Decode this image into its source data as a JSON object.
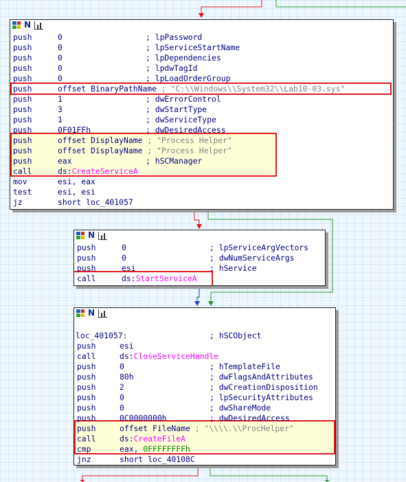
{
  "colors": {
    "canvas_bg": "#eef7fd",
    "code_text": "#000080",
    "api_name": "#ff00ff",
    "numeric_constant": "#008000",
    "string_comment": "#808080",
    "highlight_bg": "#ffffd7",
    "annotation_box": "#e0191e",
    "edge_taken": "#e0191e",
    "edge_not_taken": "#2a9a2a",
    "edge_unconditional": "#1e40c8"
  },
  "node_header_icons": [
    "graph-overview-icon",
    "node-name-icon",
    "node-stats-icon"
  ],
  "blocks": [
    {
      "id": "block1",
      "lines": [
        {
          "mnemonic": "push",
          "operand": "0",
          "comment": "; lpPassword"
        },
        {
          "mnemonic": "push",
          "operand": "0",
          "comment": "; lpServiceStartName"
        },
        {
          "mnemonic": "push",
          "operand": "0",
          "comment": "; lpDependencies"
        },
        {
          "mnemonic": "push",
          "operand": "0",
          "comment": "; lpdwTagId"
        },
        {
          "mnemonic": "push",
          "operand": "0",
          "comment": "; lpLoadOrderGroup"
        },
        {
          "mnemonic": "push",
          "operand": "offset BinaryPathName",
          "comment": "; \"C:\\\\Windows\\\\System32\\\\Lab10-03.sys\""
        },
        {
          "mnemonic": "push",
          "operand": "1",
          "comment": "; dwErrorControl"
        },
        {
          "mnemonic": "push",
          "operand": "3",
          "comment": "; dwStartType"
        },
        {
          "mnemonic": "push",
          "operand": "1",
          "comment": "; dwServiceType"
        },
        {
          "mnemonic": "push",
          "operand": "0F01FFh",
          "comment": "; dwDesiredAccess"
        },
        {
          "mnemonic": "push",
          "operand": "offset DisplayName",
          "comment": "; \"Process Helper\""
        },
        {
          "mnemonic": "push",
          "operand": "offset DisplayName",
          "comment": "; \"Process Helper\""
        },
        {
          "mnemonic": "push",
          "operand": "eax",
          "comment": "; hSCManager"
        },
        {
          "mnemonic": "call",
          "operand": "ds:",
          "operand_api": "CreateServiceA",
          "comment": ""
        },
        {
          "mnemonic": "mov",
          "operand": "esi, eax",
          "comment": ""
        },
        {
          "mnemonic": "test",
          "operand": "esi, esi",
          "comment": ""
        },
        {
          "mnemonic": "jz",
          "operand": "short loc_401057",
          "comment": ""
        }
      ]
    },
    {
      "id": "block2",
      "lines": [
        {
          "mnemonic": "push",
          "operand": "0",
          "comment": "; lpServiceArgVectors"
        },
        {
          "mnemonic": "push",
          "operand": "0",
          "comment": "; dwNumServiceArgs"
        },
        {
          "mnemonic": "push",
          "operand": "esi",
          "comment": "; hService"
        },
        {
          "mnemonic": "call",
          "operand": "ds:",
          "operand_api": "StartServiceA",
          "comment": ""
        }
      ]
    },
    {
      "id": "block3",
      "label_line": {
        "label": "loc_401057:",
        "comment": "; hSCObject"
      },
      "lines": [
        {
          "mnemonic": "push",
          "operand": "esi",
          "comment": ""
        },
        {
          "mnemonic": "call",
          "operand": "ds:",
          "operand_api": "CloseServiceHandle",
          "comment": ""
        },
        {
          "mnemonic": "push",
          "operand": "0",
          "comment": "; hTemplateFile"
        },
        {
          "mnemonic": "push",
          "operand": "80h",
          "comment": "; dwFlagsAndAttributes"
        },
        {
          "mnemonic": "push",
          "operand": "2",
          "comment": "; dwCreationDisposition"
        },
        {
          "mnemonic": "push",
          "operand": "0",
          "comment": "; lpSecurityAttributes"
        },
        {
          "mnemonic": "push",
          "operand": "0",
          "comment": "; dwShareMode"
        },
        {
          "mnemonic": "push",
          "operand": "0C0000000h",
          "comment": "; dwDesiredAccess"
        },
        {
          "mnemonic": "push",
          "operand": "offset FileName",
          "comment": "; \"\\\\\\\\.\\\\ProcHelper\""
        },
        {
          "mnemonic": "call",
          "operand": "ds:",
          "operand_api": "CreateFileA",
          "comment": ""
        },
        {
          "mnemonic": "cmp",
          "operand": "eax, ",
          "operand_num": "0FFFFFFFFh",
          "comment": ""
        },
        {
          "mnemonic": "jnz",
          "operand": "short loc_40108C",
          "comment": ""
        }
      ]
    }
  ]
}
